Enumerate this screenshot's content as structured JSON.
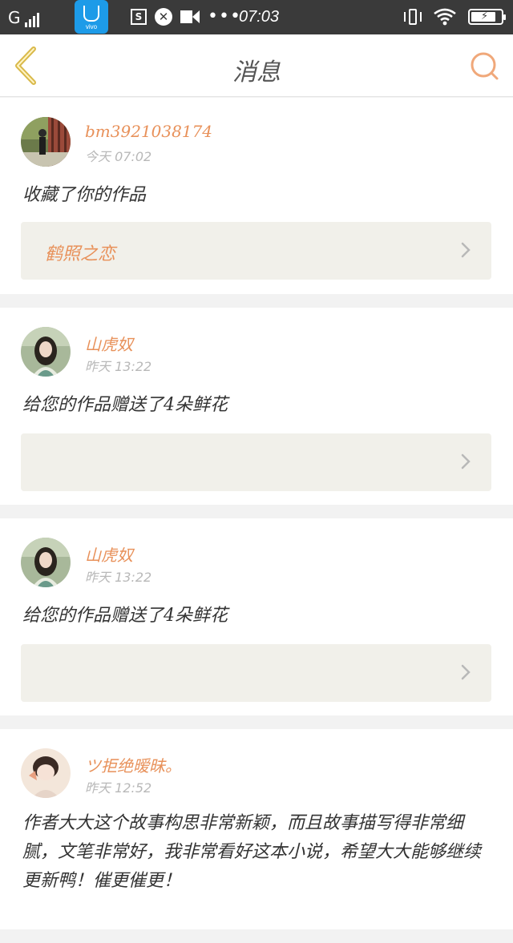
{
  "status_bar": {
    "carrier": "G",
    "app_label": "vivo",
    "s_icon": "S",
    "close_glyph": "✕",
    "dots": "•••",
    "time": "07:03",
    "charging_glyph": "⚡"
  },
  "header": {
    "title": "消息",
    "back_icon": "chevron-left-icon",
    "search_icon": "search-icon"
  },
  "colors": {
    "accent": "#e8915a",
    "back_arrow": "#d9b94a",
    "card_box": "#f1f0ea",
    "status_bar": "#3a3a3a"
  },
  "messages": [
    {
      "username": "bm3921038174",
      "time": "今天 07:02",
      "text": "收藏了你的作品",
      "work_title": "鹤照之恋"
    },
    {
      "username": "山虎奴",
      "time": "昨天 13:22",
      "text": "给您的作品赠送了4朵鲜花",
      "work_title": ""
    },
    {
      "username": "山虎奴",
      "time": "昨天 13:22",
      "text": "给您的作品赠送了4朵鲜花",
      "work_title": ""
    },
    {
      "username": "ツ拒绝暧昧。",
      "time": "昨天 12:52",
      "text": "作者大大这个故事构思非常新颖，而且故事描写得非常细腻，文笔非常好，我非常看好这本小说，希望大大能够继续更新鸭！催更催更！",
      "work_title": ""
    }
  ]
}
